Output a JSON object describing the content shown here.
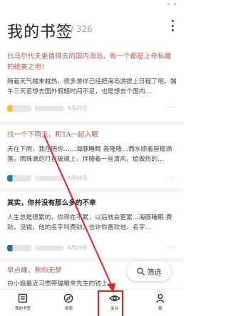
{
  "header": {
    "title": "我的书签",
    "count": "/ 326"
  },
  "cards": [
    {
      "head": "比马尔代夫更值得去的国内海岛，每一个都是上帝私藏的绝美之地！",
      "body": "随着天气越来越热，很多游伴已经把海岛游提上日程了吧。端午三天若想去国外假期时间不足，也是想去个国内…",
      "date": "6月25日",
      "avatar_color": "#f0c040"
    },
    {
      "head": "找一个下雨天，和TA一起入眠",
      "body": "天在下雨，我在陪你……海豚睡眠 轰隆隆…而水顺着屋檐滴落，雨珠滴的打在玻璃上，伴随着一丝清风，给做热的…",
      "date": "6月24日",
      "avatar_color": "#2a7ea0"
    },
    {
      "head": "其实，你并没有那么多的不幸",
      "body": "人生总是很累的，你现在不累，以后就会更累…海豚睡眠 费劲，没错，他的名字叫费劲，也许你喜欢他，名字…",
      "date": "6月24日",
      "avatar_color": "#2a6e8a"
    },
    {
      "head": "早点睡，熬你无梦",
      "body": "白小姐最近习惯带猫粮来先生的钱上…",
      "date": "",
      "avatar_color": "#cccccc"
    }
  ],
  "more_glyph": "···",
  "filter": {
    "label": "筛选"
  },
  "tabs": [
    {
      "label": "我的书签",
      "icon": "book-icon"
    },
    {
      "label": "发现",
      "icon": "compass-icon"
    },
    {
      "label": "关注",
      "icon": "eye-icon"
    },
    {
      "label": "我",
      "icon": "user-icon"
    }
  ],
  "highlight_color": "#e02020"
}
